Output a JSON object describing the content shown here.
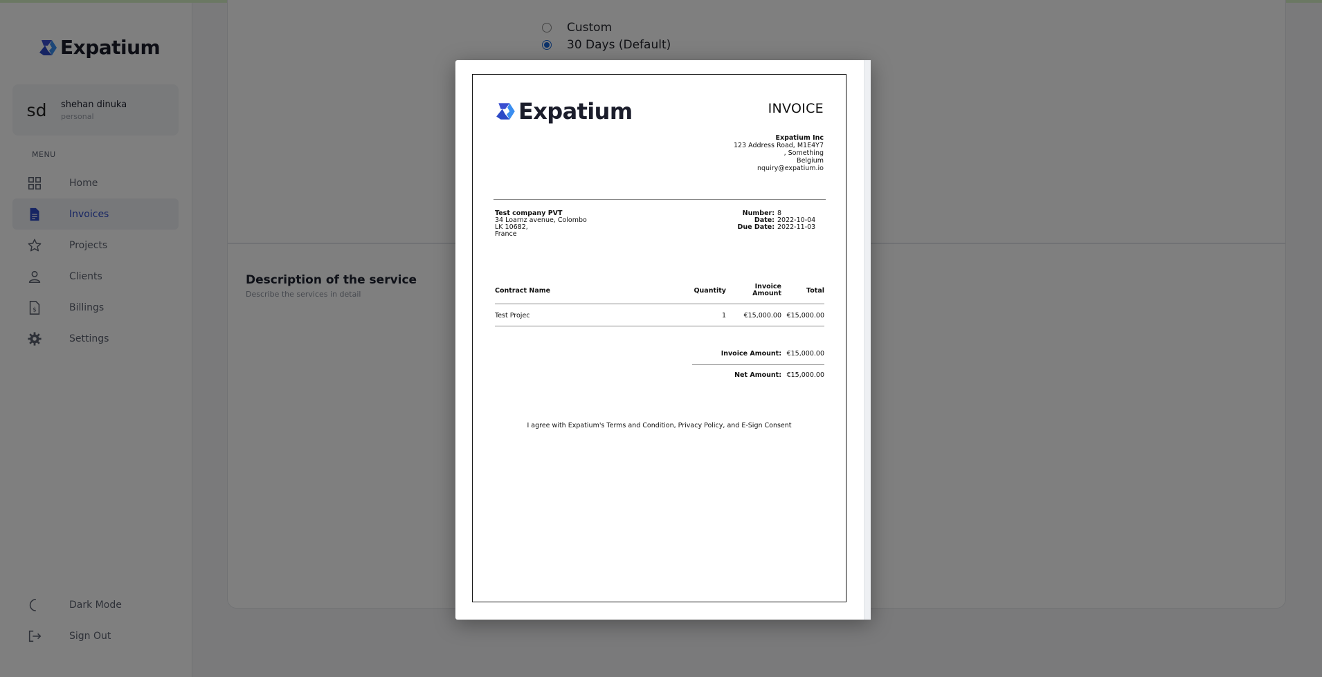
{
  "brand": {
    "name": "Expatium",
    "accent": "#2c49c6"
  },
  "user": {
    "initials": "sd",
    "name": "shehan dinuka",
    "type": "personal"
  },
  "sidebar": {
    "menu_label": "MENU",
    "items": [
      {
        "label": "Home",
        "icon": "grid-icon"
      },
      {
        "label": "Invoices",
        "icon": "document-icon",
        "active": true
      },
      {
        "label": "Projects",
        "icon": "star-icon"
      },
      {
        "label": "Clients",
        "icon": "user-icon"
      },
      {
        "label": "Billings",
        "icon": "billing-icon"
      },
      {
        "label": "Settings",
        "icon": "gear-icon"
      }
    ],
    "bottom": [
      {
        "label": "Dark Mode",
        "icon": "moon-icon"
      },
      {
        "label": "Sign Out",
        "icon": "sign-out-icon"
      }
    ]
  },
  "main": {
    "payment_terms": [
      {
        "label": "Custom",
        "checked": false
      },
      {
        "label": "30 Days (Default)",
        "checked": true
      }
    ],
    "service_section": {
      "title": "Description of the service",
      "subtitle": "Describe the services in detail"
    }
  },
  "invoice": {
    "title": "INVOICE",
    "company": {
      "name": "Expatium Inc",
      "address_line1": "123 Address Road, M1E4Y7",
      "address_line2": ", Something",
      "country": "Belgium",
      "email": "nquiry@expatium.io"
    },
    "bill_to": {
      "name": "Test company PVT",
      "address_line1": "34 Loarnz avenue, Colombo",
      "address_line2": "LK 10682,",
      "country": "France"
    },
    "meta": {
      "number_label": "Number:",
      "number": "8",
      "date_label": "Date:",
      "date": "2022-10-04",
      "due_label": "Due Date:",
      "due": "2022-11-03"
    },
    "table": {
      "headers": {
        "contract": "Contract Name",
        "quantity": "Quantity",
        "invoice_amount_l1": "Invoice",
        "invoice_amount_l2": "Amount",
        "total": "Total"
      },
      "rows": [
        {
          "contract": "Test Projec",
          "quantity": "1",
          "amount": "€15,000.00",
          "total": "€15,000.00"
        }
      ]
    },
    "summary": {
      "invoice_amount_label": "Invoice Amount:",
      "invoice_amount": "€15,000.00",
      "net_amount_label": "Net Amount:",
      "net_amount": "€15,000.00"
    },
    "agreement": "I agree with Expatium's Terms and Condition, Privacy Policy, and E-Sign Consent"
  }
}
